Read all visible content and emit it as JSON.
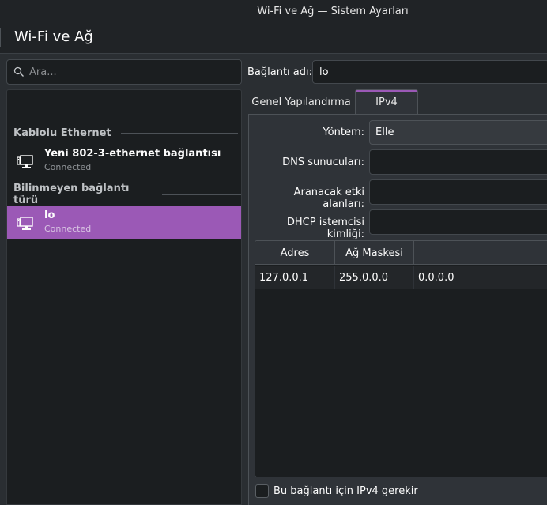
{
  "window": {
    "title": "Wi-Fi ve Ağ — Sistem Ayarları"
  },
  "header": {
    "title": "Wi-Fi ve Ağ"
  },
  "sidebar": {
    "search_placeholder": "Ara...",
    "sections": [
      {
        "title": "Kablolu Ethernet"
      },
      {
        "title": "Bilinmeyen bağlantı türü"
      }
    ],
    "connections": [
      {
        "name": "Yeni 802-3-ethernet bağlantısı",
        "status": "Connected",
        "icon": "network-wired-icon"
      },
      {
        "name": "lo",
        "status": "Connected",
        "icon": "network-wired-icon",
        "selected": true
      }
    ]
  },
  "details": {
    "name_label": "Bağlantı adı:",
    "name_value": "lo",
    "tabs": [
      {
        "label": "Genel Yapılandırma"
      },
      {
        "label": "IPv4",
        "active": true
      }
    ],
    "method_label": "Yöntem:",
    "method_value": "Elle",
    "dns_label": "DNS sunucuları:",
    "search_domains_label": "Aranacak etki alanları:",
    "dhcp_client_label": "DHCP istemcisi kimliği:",
    "table": {
      "columns": [
        "Adres",
        "Ağ Maskesi"
      ],
      "rows": [
        [
          "127.0.0.1",
          "255.0.0.0",
          "0.0.0.0"
        ]
      ]
    },
    "require_ipv4_label": "Bu bağlantı için IPv4 gerekir"
  },
  "colors": {
    "accent": "#9b59b6",
    "background": "#2a2e32",
    "field": "#1b1e20"
  }
}
